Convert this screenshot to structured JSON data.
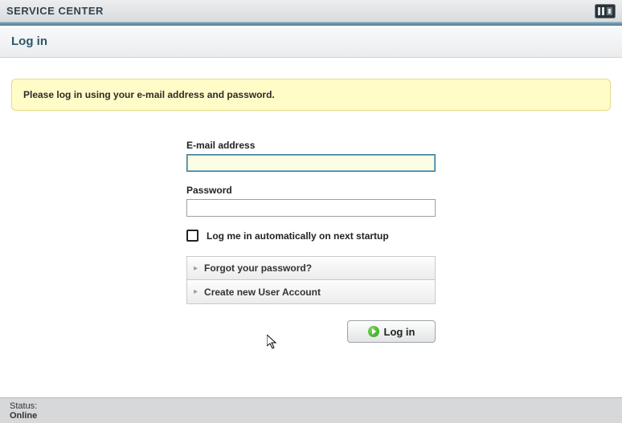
{
  "app": {
    "title": "SERVICE CENTER"
  },
  "header": {
    "page_title": "Log in"
  },
  "notice": {
    "message": "Please log in using your e-mail address and password."
  },
  "form": {
    "email_label": "E-mail address",
    "email_value": "",
    "password_label": "Password",
    "password_value": "",
    "auto_login_label": "Log me in automatically on next startup",
    "auto_login_checked": false
  },
  "links": {
    "forgot": "Forgot your password?",
    "create": "Create new User Account"
  },
  "buttons": {
    "login": "Log in"
  },
  "status": {
    "label": "Status:",
    "value": "Online"
  }
}
